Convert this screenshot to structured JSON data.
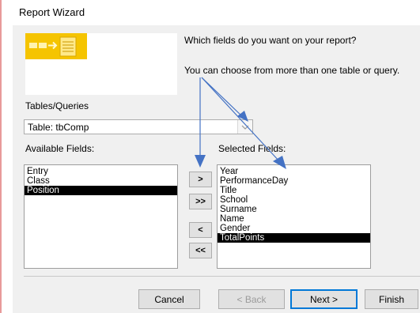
{
  "window": {
    "title": "Report Wizard"
  },
  "intro": {
    "line1": "Which fields do you want on your report?",
    "line2": "You can choose from more than one table or query."
  },
  "tables_queries": {
    "label": "Tables/Queries",
    "selected": "Table: tbComp"
  },
  "available": {
    "label": "Available Fields:",
    "items": [
      {
        "text": "Entry",
        "selected": false
      },
      {
        "text": "Class",
        "selected": false
      },
      {
        "text": "Position",
        "selected": true
      }
    ]
  },
  "selected_fields": {
    "label": "Selected Fields:",
    "items": [
      {
        "text": "Year",
        "selected": false
      },
      {
        "text": "PerformanceDay",
        "selected": false
      },
      {
        "text": "Title",
        "selected": false
      },
      {
        "text": "School",
        "selected": false
      },
      {
        "text": "Surname",
        "selected": false
      },
      {
        "text": "Name",
        "selected": false
      },
      {
        "text": "Gender",
        "selected": false
      },
      {
        "text": "TotalPoints",
        "selected": true
      }
    ]
  },
  "move_buttons": {
    "add_one": ">",
    "add_all": ">>",
    "remove_one": "<",
    "remove_all": "<<"
  },
  "footer": {
    "cancel": "Cancel",
    "back": "< Back",
    "next": "Next >",
    "finish": "Finish"
  },
  "colors": {
    "selection": "#000000",
    "annotation_arrow": "#4472c4",
    "accent_border": "#0078d7"
  }
}
